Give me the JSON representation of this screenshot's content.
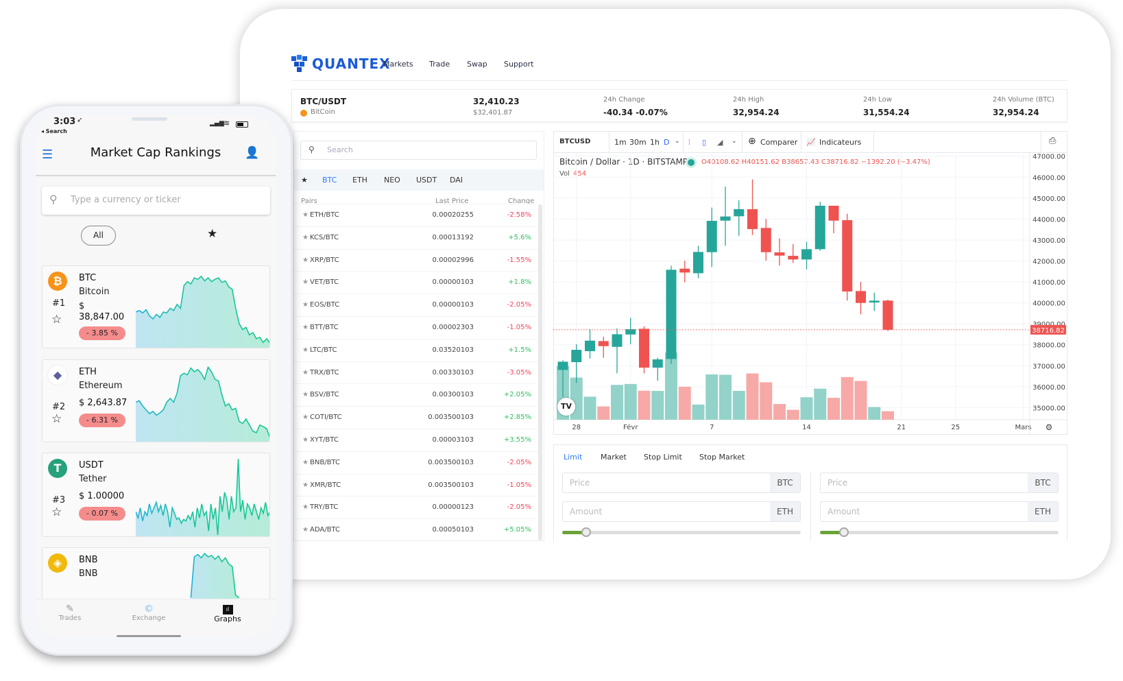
{
  "desktop": {
    "brand": "QUANTEX",
    "nav": [
      "Markets",
      "Trade",
      "Swap",
      "Support"
    ],
    "ticker": {
      "pair": "BTC/USDT",
      "coin": "BitCoin",
      "price": "32,410.23",
      "price_usd": "$32,401.87",
      "stats": [
        {
          "label": "24h Change",
          "value": "-40.34 -0.07%"
        },
        {
          "label": "24h High",
          "value": "32,954.24"
        },
        {
          "label": "24h Low",
          "value": "31,554.24"
        },
        {
          "label": "24h Volume (BTC)",
          "value": "32,954.24"
        }
      ]
    },
    "pairs": {
      "search_placeholder": "Search",
      "tabs": [
        "★",
        "BTC",
        "ETH",
        "NEO",
        "USDT",
        "DAI"
      ],
      "active_tab": "BTC",
      "headers": {
        "pair": "Pairs",
        "price": "Last Price",
        "change": "Change"
      },
      "rows": [
        {
          "pair": "ETH/BTC",
          "price": "0.00020255",
          "change": "-2.58%"
        },
        {
          "pair": "KCS/BTC",
          "price": "0.00013192",
          "change": "+5.6%"
        },
        {
          "pair": "XRP/BTC",
          "price": "0.00002996",
          "change": "-1.55%"
        },
        {
          "pair": "VET/BTC",
          "price": "0.00000103",
          "change": "+1.8%"
        },
        {
          "pair": "EOS/BTC",
          "price": "0.00000103",
          "change": "-2.05%"
        },
        {
          "pair": "BTT/BTC",
          "price": "0.00002303",
          "change": "-1.05%"
        },
        {
          "pair": "LTC/BTC",
          "price": "0.03520103",
          "change": "+1.5%"
        },
        {
          "pair": "TRX/BTC",
          "price": "0.00330103",
          "change": "-3.05%"
        },
        {
          "pair": "BSV/BTC",
          "price": "0.00300103",
          "change": "+2.05%"
        },
        {
          "pair": "COTI/BTC",
          "price": "0.003500103",
          "change": "+2.85%"
        },
        {
          "pair": "XYT/BTC",
          "price": "0.00003103",
          "change": "+3.55%"
        },
        {
          "pair": "BNB/BTC",
          "price": "0.003500103",
          "change": "-2.05%"
        },
        {
          "pair": "XMR/BTC",
          "price": "0.003500103",
          "change": "-1.05%"
        },
        {
          "pair": "TRY/BTC",
          "price": "0.00000123",
          "change": "-2.05%"
        },
        {
          "pair": "ADA/BTC",
          "price": "0.00050103",
          "change": "+5.05%"
        }
      ]
    },
    "chart_toolbar": {
      "symbol": "BTCUSD",
      "intervals": [
        "1m",
        "30m",
        "1h",
        "D"
      ],
      "active_interval": "D",
      "compare": "Comparer",
      "indicators": "Indicateurs"
    },
    "order": {
      "tabs": [
        "Limit",
        "Market",
        "Stop Limit",
        "Stop Market"
      ],
      "active_tab": "Limit",
      "price_placeholder": "Price",
      "amount_placeholder": "Amount",
      "price_unit": "BTC",
      "amount_unit": "ETH",
      "buy_slider_percent": 10,
      "sell_slider_percent": 10
    }
  },
  "chart_data": {
    "type": "candlestick",
    "title": "Bitcoin / Dollar · 1D · BITSTAMP",
    "ohlc_legend": {
      "o": "O40108.62",
      "h": "H40151.62",
      "l": "B38657.43",
      "c": "C38716.82",
      "change": "−1392.20 (−3.47%)"
    },
    "volume_label": "Vol",
    "volume_value": "454",
    "last_price": 38716.82,
    "last_price_label": "38716.82",
    "ylim": [
      34700,
      47300
    ],
    "y_ticks": [
      "47000.00",
      "46000.00",
      "45000.00",
      "44000.00",
      "43000.00",
      "42000.00",
      "41000.00",
      "40000.00",
      "39000.00",
      "38000.00",
      "37000.00",
      "36000.00",
      "35000.00"
    ],
    "x_ticks": [
      {
        "label": "28",
        "date": "01-28"
      },
      {
        "label": "Févr",
        "date": "02-01"
      },
      {
        "label": "7",
        "date": "02-07"
      },
      {
        "label": "14",
        "date": "02-14"
      },
      {
        "label": "21",
        "date": "02-21"
      },
      {
        "label": "25",
        "date": "02-25"
      },
      {
        "label": "Mars",
        "date": "03-01"
      }
    ],
    "colors": {
      "up": "#26a69a",
      "down": "#ef5350"
    },
    "candles": [
      {
        "d": "01-27",
        "o": 36800,
        "h": 37258,
        "l": 35524,
        "c": 37193,
        "v": 2860
      },
      {
        "d": "01-28",
        "o": 37171,
        "h": 38022,
        "l": 36178,
        "c": 37760,
        "v": 2250
      },
      {
        "d": "01-29",
        "o": 37695,
        "h": 38742,
        "l": 37346,
        "c": 38197,
        "v": 1230
      },
      {
        "d": "01-30",
        "o": 38175,
        "h": 38393,
        "l": 37378,
        "c": 37935,
        "v": 710
      },
      {
        "d": "01-31",
        "o": 37902,
        "h": 38786,
        "l": 36637,
        "c": 38502,
        "v": 1860
      },
      {
        "d": "02-01",
        "o": 38491,
        "h": 39288,
        "l": 38033,
        "c": 38742,
        "v": 1910
      },
      {
        "d": "02-02",
        "o": 38764,
        "h": 38884,
        "l": 36637,
        "c": 36909,
        "v": 1550
      },
      {
        "d": "02-03",
        "o": 36909,
        "h": 37378,
        "l": 36287,
        "c": 37302,
        "v": 1540
      },
      {
        "d": "02-04",
        "o": 37324,
        "h": 41775,
        "l": 37084,
        "c": 41579,
        "v": 3580
      },
      {
        "d": "02-05",
        "o": 41633,
        "h": 42015,
        "l": 40979,
        "c": 41448,
        "v": 1760
      },
      {
        "d": "02-06",
        "o": 41415,
        "h": 42724,
        "l": 41175,
        "c": 42430,
        "v": 810
      },
      {
        "d": "02-07",
        "o": 42419,
        "h": 44546,
        "l": 41710,
        "c": 43913,
        "v": 2420
      },
      {
        "d": "02-08",
        "o": 43924,
        "h": 45550,
        "l": 42724,
        "c": 44121,
        "v": 2400
      },
      {
        "d": "02-09",
        "o": 44132,
        "h": 44895,
        "l": 43204,
        "c": 44470,
        "v": 1540
      },
      {
        "d": "02-10",
        "o": 44470,
        "h": 45888,
        "l": 43237,
        "c": 43521,
        "v": 2470
      },
      {
        "d": "02-11",
        "o": 43575,
        "h": 44001,
        "l": 42015,
        "c": 42419,
        "v": 2000
      },
      {
        "d": "02-12",
        "o": 42408,
        "h": 43073,
        "l": 41775,
        "c": 42255,
        "v": 840
      },
      {
        "d": "02-13",
        "o": 42244,
        "h": 42801,
        "l": 41906,
        "c": 42070,
        "v": 530
      },
      {
        "d": "02-14",
        "o": 42070,
        "h": 42910,
        "l": 41601,
        "c": 42561,
        "v": 1200
      },
      {
        "d": "02-15",
        "o": 42561,
        "h": 44819,
        "l": 42484,
        "c": 44634,
        "v": 1660
      },
      {
        "d": "02-16",
        "o": 44634,
        "h": 44634,
        "l": 43324,
        "c": 43924,
        "v": 1170
      },
      {
        "d": "02-17",
        "o": 43946,
        "h": 44252,
        "l": 40106,
        "c": 40542,
        "v": 2280
      },
      {
        "d": "02-18",
        "o": 40564,
        "h": 41000,
        "l": 39451,
        "c": 39997,
        "v": 2070
      },
      {
        "d": "02-19",
        "o": 40019,
        "h": 40488,
        "l": 39615,
        "c": 40106,
        "v": 680
      },
      {
        "d": "02-20",
        "o": 40108.62,
        "h": 40151.62,
        "l": 38657.43,
        "c": 38716.82,
        "v": 454
      }
    ]
  },
  "phone": {
    "time": "3:03",
    "back_label": "◂ Search",
    "title": "Market Cap Rankings",
    "search_placeholder": "Type a currency or ticker",
    "filter_all": "All",
    "coins": [
      {
        "symbol": "BTC",
        "name": "Bitcoin",
        "rank": "#1",
        "price": "$ 38,847.00",
        "change": "- 3.85 %",
        "color": "#f7931a",
        "glyph": "₿",
        "spark": [
          0.45,
          0.47,
          0.44,
          0.48,
          0.4,
          0.36,
          0.42,
          0.38,
          0.45,
          0.44,
          0.5,
          0.47,
          0.55,
          0.5,
          0.8,
          0.85,
          0.82,
          0.9,
          0.88,
          0.92,
          0.86,
          0.9,
          0.85,
          0.88,
          0.9,
          0.84,
          0.86,
          0.78,
          0.75,
          0.5,
          0.3,
          0.22,
          0.25,
          0.15,
          0.18,
          0.1,
          0.12,
          0.05,
          0.1,
          0.04
        ]
      },
      {
        "symbol": "ETH",
        "name": "Ethereum",
        "rank": "#2",
        "price": "$ 2,643.87",
        "change": "- 6.31 %",
        "color": "#ffffff",
        "glyph": "◆",
        "spark": [
          0.5,
          0.52,
          0.45,
          0.4,
          0.35,
          0.38,
          0.33,
          0.36,
          0.4,
          0.5,
          0.55,
          0.5,
          0.62,
          0.85,
          0.88,
          0.86,
          0.95,
          0.9,
          0.93,
          0.88,
          0.8,
          0.96,
          0.9,
          0.8,
          0.78,
          0.6,
          0.45,
          0.48,
          0.4,
          0.42,
          0.25,
          0.22,
          0.28,
          0.2,
          0.12,
          0.1,
          0.2,
          0.18,
          0.15,
          0.03
        ]
      },
      {
        "symbol": "USDT",
        "name": "Tether",
        "rank": "#3",
        "price": "$ 1.00000",
        "change": "- 0.07 %",
        "color": "#26a17b",
        "glyph": "T",
        "spark": [
          0.3,
          0.22,
          0.35,
          0.18,
          0.3,
          0.25,
          0.4,
          0.28,
          0.35,
          0.42,
          0.3,
          0.38,
          0.25,
          0.4,
          0.3,
          0.1,
          0.35,
          0.28,
          0.2,
          0.22,
          0.15,
          0.2,
          0.18,
          0.25,
          0.2,
          0.3,
          0.1,
          0.35,
          0.22,
          0.4,
          0.25,
          0.3,
          0.05,
          0.4,
          0.2,
          0.35,
          0.0,
          0.5,
          0.3,
          0.55,
          0.45,
          0.2,
          0.5,
          0.3,
          0.35,
          0.98,
          0.3,
          0.45,
          0.2,
          0.4,
          0.35,
          0.25,
          0.4,
          0.3,
          0.2,
          0.35,
          0.28,
          0.42,
          0.25,
          0.3
        ]
      },
      {
        "symbol": "BNB",
        "name": "BNB",
        "color": "#f0b90b",
        "glyph": "◈",
        "spark": [
          null,
          null,
          null,
          null,
          null,
          null,
          null,
          null,
          null,
          null,
          null,
          null,
          null,
          null,
          null,
          null,
          0.05,
          0.9,
          0.95,
          0.88,
          0.97,
          0.9,
          0.93,
          0.85,
          0.92,
          0.8,
          0.88,
          0.75,
          0.7,
          0.1,
          0.05,
          null,
          null,
          null,
          null,
          null,
          null,
          null,
          null,
          null
        ]
      }
    ],
    "bottom_nav": [
      {
        "label": "Trades",
        "active": false
      },
      {
        "label": "Exchange",
        "active": false
      },
      {
        "label": "Graphs",
        "active": true
      }
    ]
  }
}
